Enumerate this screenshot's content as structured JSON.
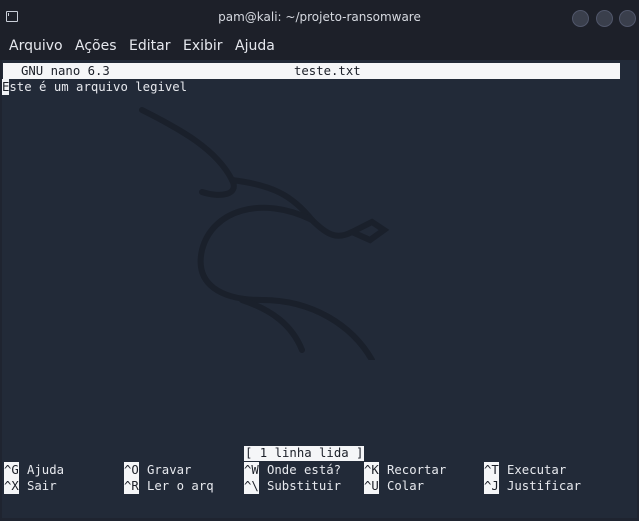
{
  "window": {
    "title": "pam@kali: ~/projeto-ransomware"
  },
  "menu": {
    "items": [
      "Arquivo",
      "Ações",
      "Editar",
      "Exibir",
      "Ajuda"
    ]
  },
  "nano": {
    "version_label": "GNU nano 6.3",
    "filename": "teste.txt",
    "content_first_char": "E",
    "content_rest": "ste é um arquivo legivel",
    "status_message": "[ 1 linha lida ]"
  },
  "shortcuts": {
    "row1": [
      {
        "key": "^G",
        "label": "Ajuda"
      },
      {
        "key": "^O",
        "label": "Gravar"
      },
      {
        "key": "^W",
        "label": "Onde está?"
      },
      {
        "key": "^K",
        "label": "Recortar"
      },
      {
        "key": "^T",
        "label": "Executar"
      }
    ],
    "row2": [
      {
        "key": "^X",
        "label": "Sair"
      },
      {
        "key": "^R",
        "label": "Ler o arq"
      },
      {
        "key": "^\\",
        "label": "Substituir"
      },
      {
        "key": "^U",
        "label": "Colar"
      },
      {
        "key": "^J",
        "label": "Justificar"
      }
    ]
  },
  "colors": {
    "terminal_bg": "#222a38",
    "titlebar_bg": "#1d2029",
    "text": "#e7e9ee",
    "inverse_bg": "#f5f6f8"
  },
  "icons": {
    "terminal": "terminal-icon",
    "background": "kali-dragon-icon"
  }
}
